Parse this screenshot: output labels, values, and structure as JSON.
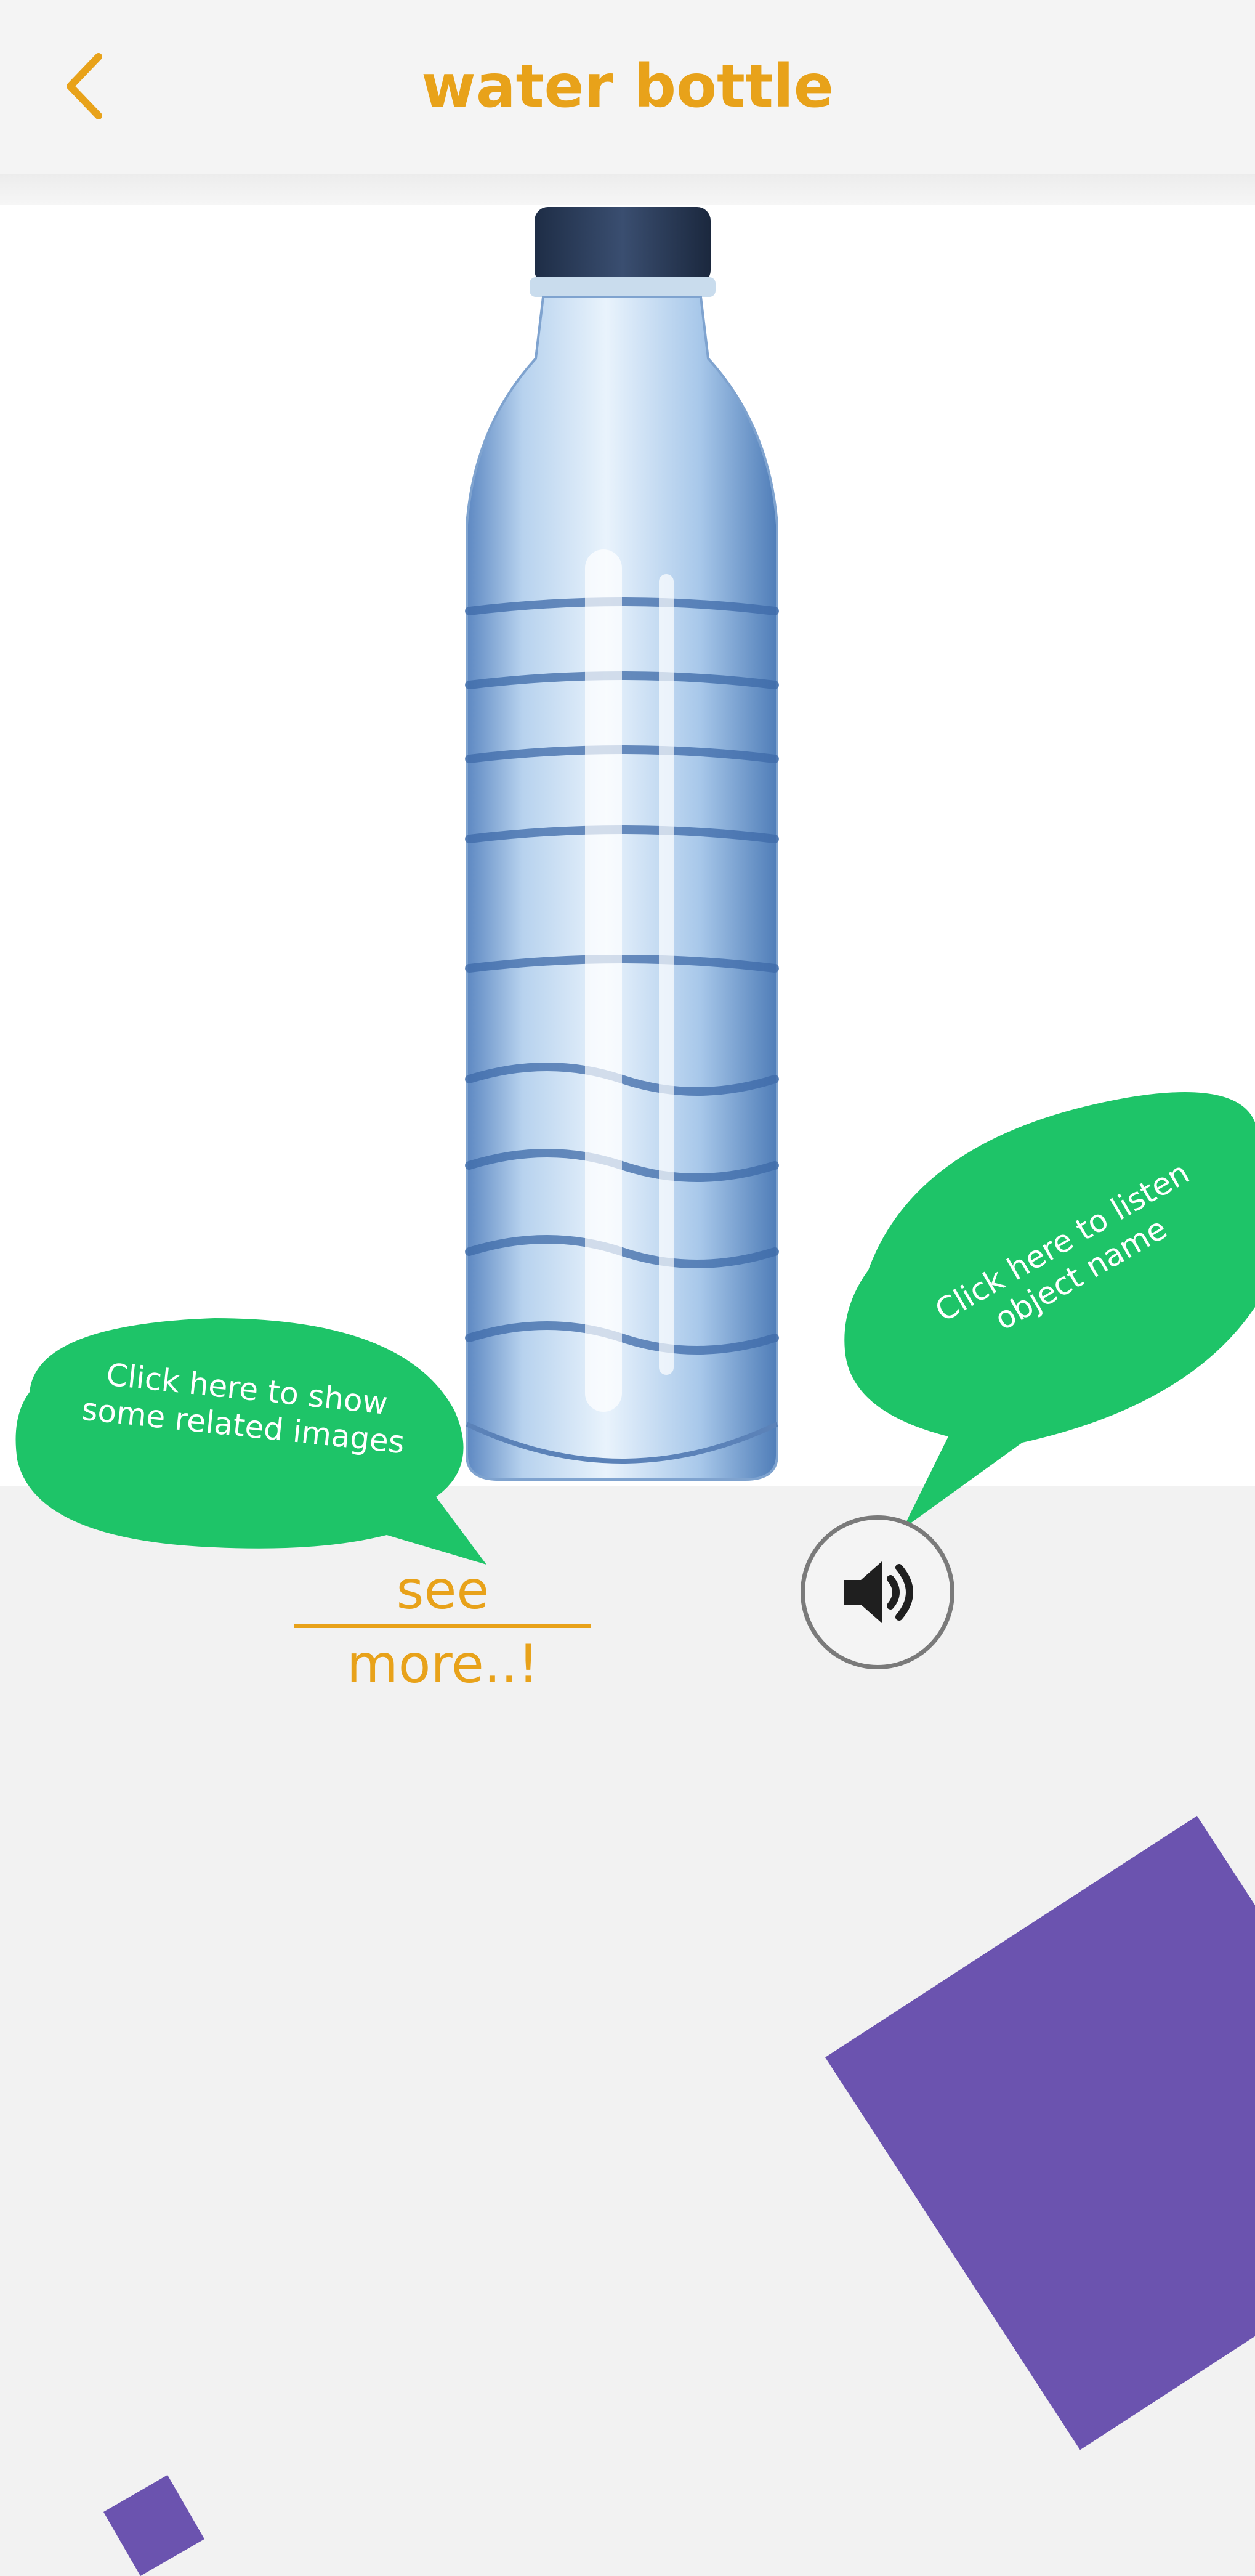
{
  "header": {
    "title": "water bottle",
    "back_icon": "chevron-left-icon"
  },
  "image": {
    "subject": "water-bottle-image"
  },
  "hints": {
    "show_related": "Click here to show some related images",
    "show_related_line1": "Click here to show",
    "show_related_line2": "some related images",
    "listen": "Click here to listen object name",
    "listen_line1": "Click here to listen",
    "listen_line2": "object name"
  },
  "actions": {
    "see_more_label": "see more..!",
    "sound_icon": "speaker-volume-icon"
  },
  "colors": {
    "accent": "#e8a21a",
    "bubble": "#1ec468",
    "decor": "#6b53af",
    "background": "#f2f2f2"
  }
}
